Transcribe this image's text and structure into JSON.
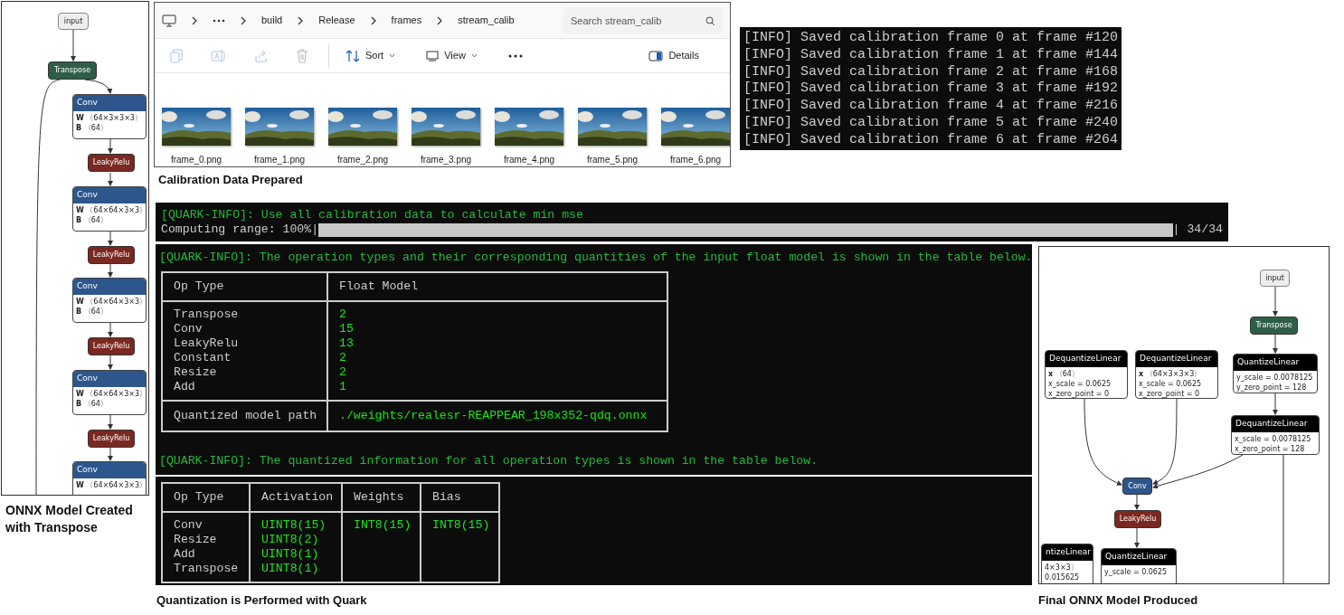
{
  "input_model": {
    "nodes": [
      {
        "kind": "input",
        "label": "input"
      },
      {
        "kind": "op",
        "label": "Transpose",
        "color": "#2f5e48"
      },
      {
        "kind": "attr",
        "label": "Conv",
        "color": "#2d568c",
        "attributes": [
          "**W** 〈64×3×3×3〉",
          "**B** 〈64〉"
        ]
      },
      {
        "kind": "op",
        "label": "LeakyRelu",
        "color": "#7b2820"
      },
      {
        "kind": "attr",
        "label": "Conv",
        "color": "#2d568c",
        "attributes": [
          "**W** 〈64×64×3×3〉",
          "**B** 〈64〉"
        ]
      },
      {
        "kind": "op",
        "label": "LeakyRelu",
        "color": "#7b2820"
      },
      {
        "kind": "attr",
        "label": "Conv",
        "color": "#2d568c",
        "attributes": [
          "**W** 〈64×64×3×3〉",
          "**B** 〈64〉"
        ]
      },
      {
        "kind": "op",
        "label": "LeakyRelu",
        "color": "#7b2820"
      },
      {
        "kind": "attr",
        "label": "Conv",
        "color": "#2d568c",
        "attributes": [
          "**W** 〈64×64×3×3〉",
          "**B** 〈64〉"
        ]
      },
      {
        "kind": "op",
        "label": "LeakyRelu",
        "color": "#7b2820"
      },
      {
        "kind": "attr",
        "label": "Conv",
        "color": "#2d568c",
        "attributes": [
          "**W** 〈64×64×3×3〉"
        ]
      }
    ],
    "caption": "ONNX Model Created with Transpose"
  },
  "file_explorer": {
    "breadcrumb": [
      "build",
      "Release",
      "frames",
      "stream_calib"
    ],
    "search": {
      "placeholder": "Search stream_calib"
    },
    "toolbar": [
      {
        "kind": "copy",
        "disabled": true
      },
      {
        "kind": "rename",
        "disabled": true
      },
      {
        "kind": "share",
        "disabled": true
      },
      {
        "kind": "delete",
        "disabled": true
      },
      {
        "kind": "sort",
        "label": "Sort",
        "disabled": false
      },
      {
        "kind": "view",
        "label": "View",
        "disabled": false
      },
      {
        "kind": "more",
        "disabled": false
      },
      {
        "kind": "details",
        "label": "Details",
        "disabled": false
      }
    ],
    "files": [
      "frame_0.png",
      "frame_1.png",
      "frame_2.png",
      "frame_3.png",
      "frame_4.png",
      "frame_5.png",
      "frame_6.png"
    ],
    "caption": "Calibration Data Prepared"
  },
  "calibration_log": [
    "[INFO] Saved calibration frame 0 at frame #120",
    "[INFO] Saved calibration frame 1 at frame #144",
    "[INFO] Saved calibration frame 2 at frame #168",
    "[INFO] Saved calibration frame 3 at frame #192",
    "[INFO] Saved calibration frame 4 at frame #216",
    "[INFO] Saved calibration frame 5 at frame #240",
    "[INFO] Saved calibration frame 6 at frame #264"
  ],
  "quark_progress": {
    "message": "[QUARK-INFO]: Use all calibration data to calculate min mse",
    "label": "Computing range: 100%|",
    "level": 1,
    "count": "| 34/34"
  },
  "quark_summary": {
    "message": "[QUARK-INFO]: The operation types and their corresponding quantities of the input float model is shown in the table below.",
    "table": {
      "columns": [
        "Op Type",
        "Float Model"
      ],
      "rows": [
        [
          "Transpose",
          "2"
        ],
        [
          "Conv",
          "15"
        ],
        [
          "LeakyRelu",
          "13"
        ],
        [
          "Constant",
          "2"
        ],
        [
          "Resize",
          "2"
        ],
        [
          "Add",
          "1"
        ]
      ],
      "footer": [
        "Quantized model path",
        "./weights/realesr-REAPPEAR_198x352-qdq.onnx"
      ]
    },
    "message_2": "[QUARK-INFO]: The quantized information for all operation types is shown in the table below."
  },
  "quark_quantized": {
    "table": {
      "columns": [
        "Op Type",
        "Activation",
        "Weights",
        "Bias"
      ],
      "rows": [
        [
          "Conv",
          "UINT8(15)",
          "INT8(15)",
          "INT8(15)"
        ],
        [
          "Resize",
          "UINT8(2)"
        ],
        [
          "Add",
          "UINT8(1)"
        ],
        [
          "Transpose",
          "UINT8(1)"
        ]
      ]
    },
    "caption": "Quantization is Performed with Quark"
  },
  "output_model": {
    "nodes": [
      {
        "kind": "input",
        "label": "input"
      },
      {
        "kind": "op",
        "label": "Transpose",
        "color": "#2f5e48"
      },
      {
        "kind": "attr",
        "label": "DequantizeLinear",
        "color": "#000000",
        "attributes": [
          "**x** 〈64〉",
          "x_scale = 0.0625",
          "x_zero_point = 0"
        ]
      },
      {
        "kind": "attr",
        "label": "DequantizeLinear",
        "color": "#000000",
        "attributes": [
          "**x** 〈64×3×3×3〉",
          "x_scale = 0.0625",
          "x_zero_point = 0"
        ]
      },
      {
        "kind": "attr",
        "label": "QuantizeLinear",
        "color": "#000000",
        "attributes": [
          "y_scale = 0.0078125",
          "y_zero_point = 128"
        ]
      },
      {
        "kind": "attr",
        "label": "DequantizeLinear",
        "color": "#000000",
        "attributes": [
          "x_scale = 0.0078125",
          "x_zero_point = 128"
        ]
      },
      {
        "kind": "op",
        "label": "Conv",
        "color": "#2d568c"
      },
      {
        "kind": "op",
        "label": "LeakyRelu",
        "color": "#7b2820"
      },
      {
        "kind": "attr",
        "label": "ntizeLinear",
        "color": "#000000",
        "attributes": [
          "4×3×3〉",
          "0.015625"
        ]
      },
      {
        "kind": "attr",
        "label": "QuantizeLinear",
        "color": "#000000",
        "attributes": [
          "y_scale = 0.0625"
        ]
      }
    ],
    "caption": "Final ONNX Model Produced"
  }
}
